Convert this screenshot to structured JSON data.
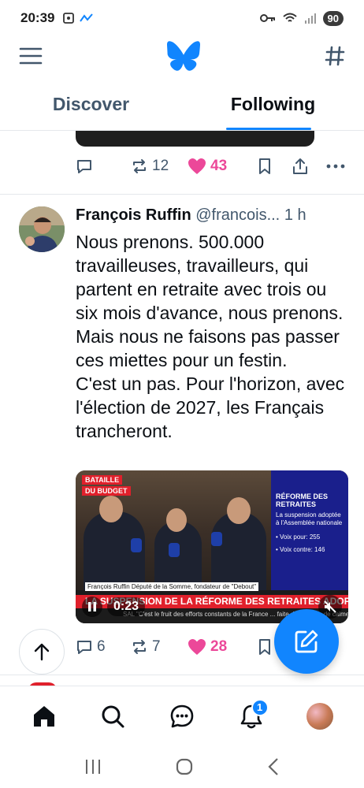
{
  "status_bar": {
    "time": "20:39",
    "battery": "90"
  },
  "tabs": [
    {
      "label": "Discover"
    },
    {
      "label": "Following"
    }
  ],
  "prev_post": {
    "reposts": "12",
    "likes": "43"
  },
  "post": {
    "author_name": "François Ruffin",
    "handle": "@francois...",
    "time": "1 h",
    "text_lines": [
      "Nous prenons. 500.000 travailleuses, travailleurs, qui partent en retraite avec trois ou six mois d'avance, nous prenons. Mais nous ne faisons pas passer ces miettes pour un festin.",
      "C'est un pas. Pour l'horizon, avec l'élection de 2027, les Français trancheront."
    ],
    "video": {
      "tag_top": "BATAILLE",
      "tag_bottom": "DU BUDGET",
      "panel_title": "RÉFORME DES RETRAITES",
      "panel_subtitle": "La suspension adoptée à l'Assemblée nationale",
      "panel_vote_for": "• Voix pour: 255",
      "panel_vote_against": "• Voix contre: 146",
      "caption_name": "François Ruffin Député de la Somme, fondateur de \"Debout\"",
      "headline": "LA SUSPENSION DE LA RÉFORME DES RETRAITES ADOPTÉE",
      "ticker": "SAL  \"C'est le fruit des efforts constants de la France ... faite de respect, de calme et d'exigence\"",
      "duration": "0:23"
    },
    "replies": "6",
    "reposts": "7",
    "likes": "28"
  },
  "bottom_nav": {
    "notifications_badge": "1"
  },
  "colors": {
    "accent": "#1185fe",
    "like": "#ec4899",
    "muted": "#42576c"
  }
}
